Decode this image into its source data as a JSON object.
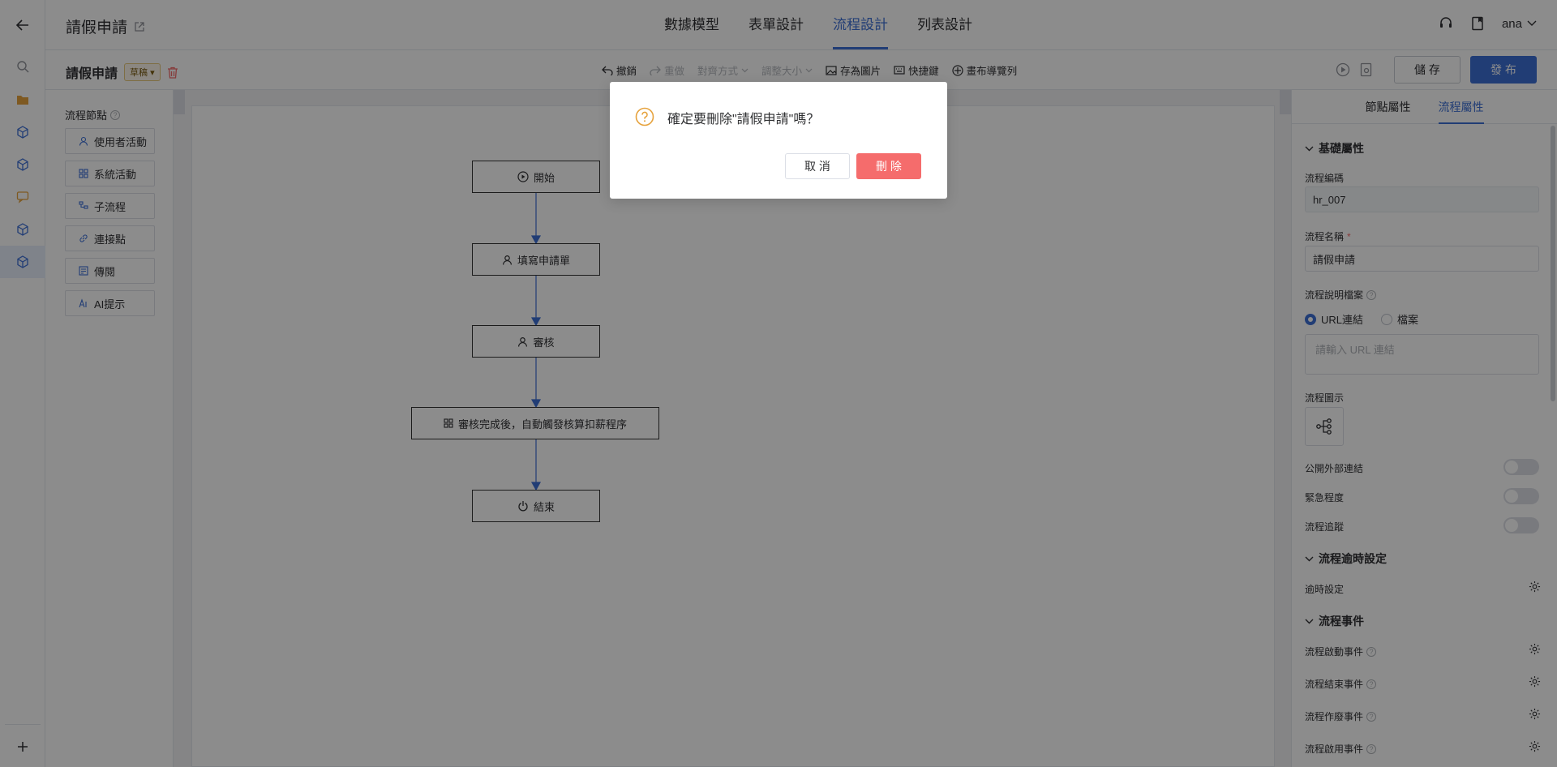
{
  "header": {
    "title": "請假申請",
    "tabs": [
      "數據模型",
      "表單設計",
      "流程設計",
      "列表設計"
    ],
    "user": "ana"
  },
  "toolbar": {
    "process_name": "請假申請",
    "status": "草稿",
    "tools": [
      {
        "label": "撤銷",
        "icon": "undo-icon",
        "enabled": true
      },
      {
        "label": "重做",
        "icon": "redo-icon",
        "enabled": false
      },
      {
        "label": "對齊方式",
        "icon": "",
        "enabled": false
      },
      {
        "label": "調整大小",
        "icon": "",
        "enabled": false
      },
      {
        "label": "存為圖片",
        "icon": "image-icon",
        "enabled": true
      },
      {
        "label": "快捷鍵",
        "icon": "keyboard-icon",
        "enabled": true
      },
      {
        "label": "畫布導覽列",
        "icon": "compass-icon",
        "enabled": true
      }
    ],
    "save_label": "儲 存",
    "publish_label": "發 布"
  },
  "palette": {
    "title": "流程節點",
    "items": [
      "使用者活動",
      "系統活動",
      "子流程",
      "連接點",
      "傳閱",
      "AI提示"
    ]
  },
  "flow": {
    "nodes": [
      "開始",
      "填寫申請單",
      "審核",
      "審核完成後，自動觸發核算扣薪程序",
      "結束"
    ]
  },
  "right_panel": {
    "tabs": [
      "節點屬性",
      "流程屬性"
    ],
    "basic_section": "基礎屬性",
    "code_label": "流程編碼",
    "code_value": "hr_007",
    "name_label": "流程名稱",
    "name_value": "請假申請",
    "doc_label": "流程說明檔案",
    "radio_url": "URL連結",
    "radio_file": "檔案",
    "url_placeholder": "請輸入 URL 連結",
    "icon_label": "流程圖示",
    "toggles": [
      "公開外部連結",
      "緊急程度",
      "流程追蹤"
    ],
    "timeout_section": "流程逾時設定",
    "timeout_label": "逾時設定",
    "events_section": "流程事件",
    "events": [
      "流程啟動事件",
      "流程結束事件",
      "流程作廢事件",
      "流程啟用事件"
    ]
  },
  "dialog": {
    "message": "確定要刪除\"請假申請\"嗎？",
    "cancel_label": "取 消",
    "delete_label": "刪 除"
  },
  "colors": {
    "accent": "#3d6fd6",
    "danger": "#f56c6c",
    "warning": "#e6a23c"
  }
}
